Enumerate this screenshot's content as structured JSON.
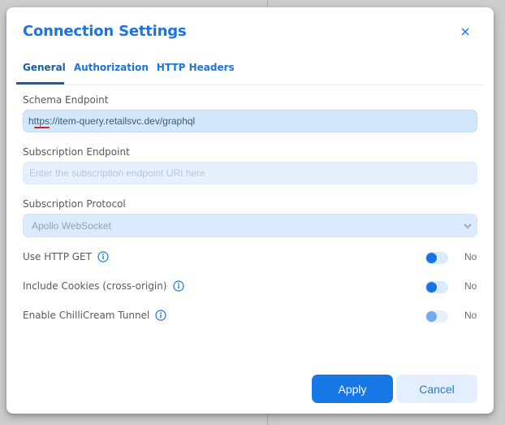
{
  "dialog": {
    "title": "Connection Settings",
    "close_icon": "close-icon",
    "tabs": [
      {
        "label": "General",
        "active": true
      },
      {
        "label": "Authorization",
        "active": false
      },
      {
        "label": "HTTP Headers",
        "active": false
      }
    ],
    "schema_endpoint": {
      "label": "Schema Endpoint",
      "value": "https://item-query.retailsvc.dev/graphql",
      "spellcheck_flag": true
    },
    "subscription_endpoint": {
      "label": "Subscription Endpoint",
      "value": "",
      "placeholder": "Enter the subscription endpoint URI here"
    },
    "subscription_protocol": {
      "label": "Subscription Protocol",
      "selected": "Apollo WebSocket",
      "chevron_icon": "chevron-down-icon"
    },
    "toggles": [
      {
        "label": "Use HTTP GET",
        "info_icon": "info-icon",
        "value": false,
        "state_text": "No",
        "disabled": false
      },
      {
        "label": "Include Cookies (cross-origin)",
        "info_icon": "info-icon",
        "value": false,
        "state_text": "No",
        "disabled": false
      },
      {
        "label": "Enable ChilliCream Tunnel",
        "info_icon": "info-icon",
        "value": false,
        "state_text": "No",
        "disabled": true
      }
    ],
    "buttons": {
      "apply": "Apply",
      "cancel": "Cancel"
    }
  },
  "colors": {
    "accent": "#1b74e0",
    "active_tab": "#1b5ea8",
    "apply_button": "#1578e6",
    "cancel_button_bg": "#e3effd",
    "input_bg": "#d2e6fc",
    "toggle_knob": "#1673e6",
    "backdrop": "#cdcdcd"
  }
}
